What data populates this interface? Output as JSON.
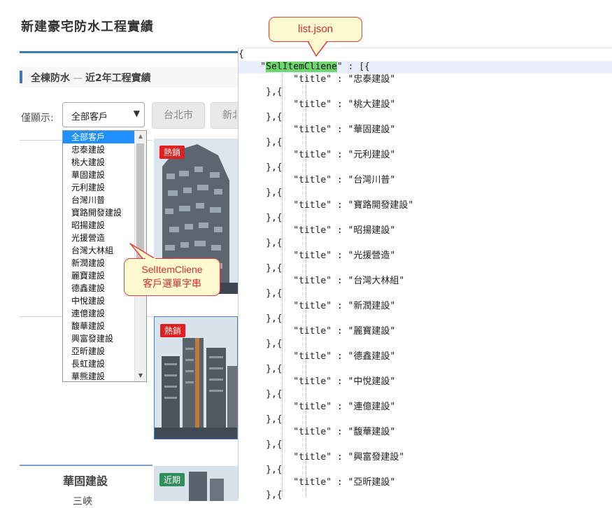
{
  "page": {
    "title": "新建豪宅防水工程實績",
    "section_title": "全棟防水",
    "section_dash": "—",
    "section_sub": "近2年工程實績",
    "filter_label": "僅顯示:"
  },
  "client_select": {
    "selected": "全部客戶",
    "arrow": "▼",
    "options": [
      "全部客戶",
      "忠泰建設",
      "桃大建設",
      "華固建設",
      "元利建設",
      "台灣川普",
      "寶路開發建設",
      "昭揚建設",
      "光援營造",
      "台灣大林組",
      "新潤建設",
      "麗寶建設",
      "德鑫建設",
      "中悅建設",
      "連億建設",
      "馥華建設",
      "興富發建設",
      "亞昕建設",
      "長虹建設",
      "華熊建設"
    ]
  },
  "city_buttons": [
    "台北市",
    "新北"
  ],
  "cards": [
    {
      "badge": "熱銷"
    },
    {
      "badge": "熱銷"
    },
    {
      "badge": "近期",
      "company": "華固建設",
      "sub": "三峽"
    }
  ],
  "code": {
    "key_name": "SelItemCliene",
    "titles": [
      "忠泰建設",
      "桃大建設",
      "華固建設",
      "元利建設",
      "台灣川普",
      "寶路開發建設",
      "昭揚建設",
      "光援營造",
      "台灣大林組",
      "新潤建設",
      "麗寶建設",
      "德鑫建設",
      "中悅建設",
      "連億建設",
      "馥華建設",
      "興富發建設",
      "亞昕建設"
    ]
  },
  "callouts": {
    "list_json": "list.json",
    "sel_line1": "SelItemCliene",
    "sel_line2": "客戶選單字串"
  },
  "scroll": {
    "up": "▲",
    "down": "▼"
  },
  "colors": {
    "accent": "#3f7ab5",
    "hot": "#e02020",
    "recent": "#2f8f5a",
    "callout_border": "#e04040",
    "key_highlight": "#6bd86b"
  }
}
